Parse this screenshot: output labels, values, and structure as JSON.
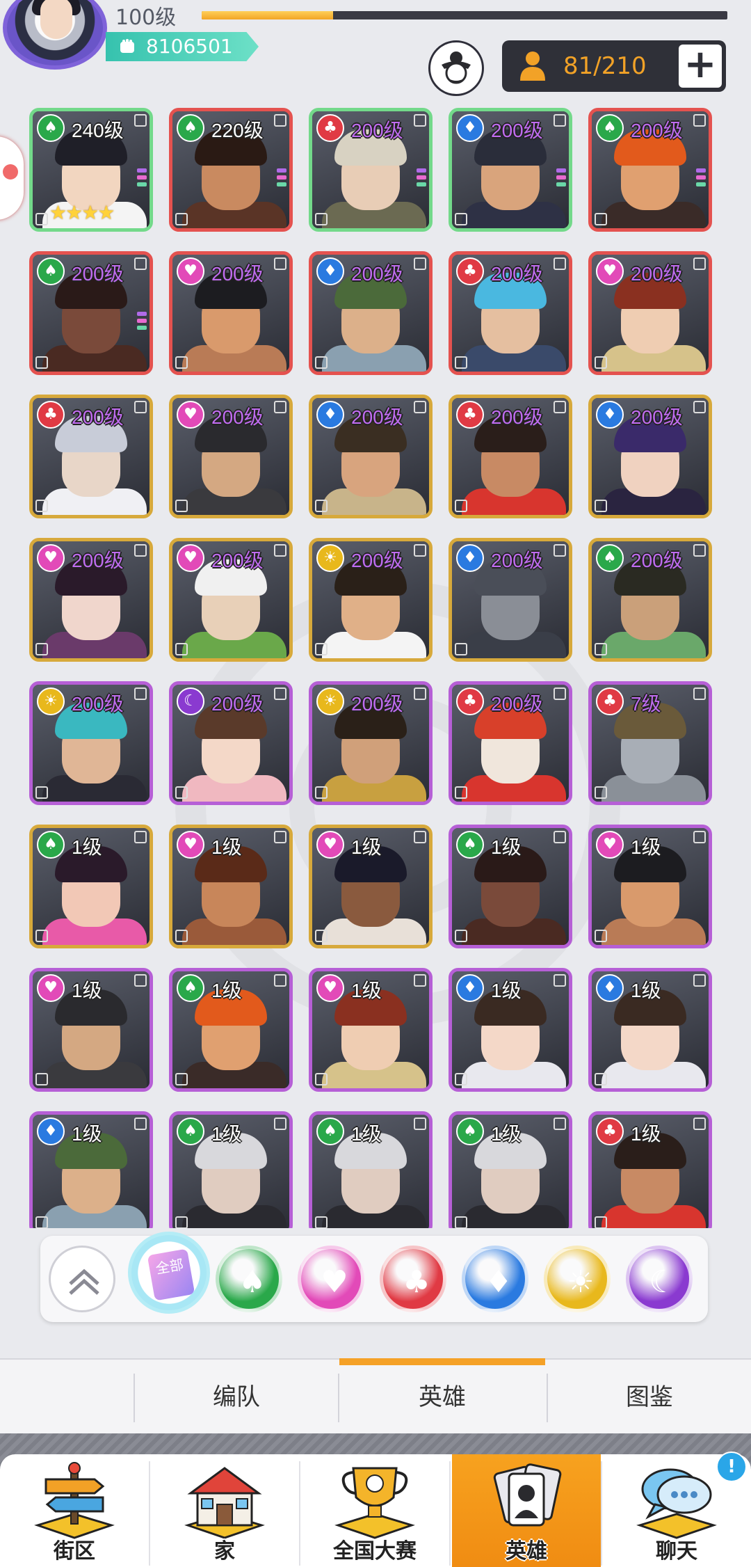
{
  "header": {
    "level": "100级",
    "xp_progress": 0.25,
    "power": "8106501",
    "capacity": "81/210",
    "plus": "+"
  },
  "heroes": [
    {
      "level": "240级",
      "suit": "spade",
      "rarity": "green",
      "stars": 4,
      "skin": "#f2d6c0",
      "hair": "#1f1f28",
      "cloth": "#f4f4f4"
    },
    {
      "level": "220级",
      "suit": "spade",
      "rarity": "red",
      "skin": "#c98a60",
      "hair": "#2a1a14",
      "cloth": "#5a3426"
    },
    {
      "level": "200级",
      "suit": "club",
      "rarity": "green",
      "skin": "#e8cdb6",
      "hair": "#d8d2c2",
      "cloth": "#6b6a52"
    },
    {
      "level": "200级",
      "suit": "diamond",
      "rarity": "green",
      "skin": "#d9a47c",
      "hair": "#2a2d3a",
      "cloth": "#2e3145"
    },
    {
      "level": "200级",
      "suit": "spade",
      "rarity": "red",
      "skin": "#e0a070",
      "hair": "#e25a1c",
      "cloth": "#3a2b28"
    },
    {
      "level": "200级",
      "suit": "spade",
      "rarity": "red",
      "skin": "#7a4a3a",
      "hair": "#2a1a18",
      "cloth": "#4a2a22"
    },
    {
      "level": "200级",
      "suit": "heart",
      "rarity": "red",
      "skin": "#d99a6c",
      "hair": "#1c1c20",
      "cloth": "#b97b56"
    },
    {
      "level": "200级",
      "suit": "diamond",
      "rarity": "red",
      "skin": "#dcb08a",
      "hair": "#4b6a3a",
      "cloth": "#8aa0b0"
    },
    {
      "level": "200级",
      "suit": "club",
      "rarity": "red",
      "skin": "#e5bfa0",
      "hair": "#4ab8e0",
      "cloth": "#3a4a6a"
    },
    {
      "level": "200级",
      "suit": "heart",
      "rarity": "red",
      "skin": "#efcdb2",
      "hair": "#8a3020",
      "cloth": "#d6c28a"
    },
    {
      "level": "200级",
      "suit": "club",
      "rarity": "gold",
      "skin": "#e8d6c8",
      "hair": "#c8ccd8",
      "cloth": "#f0f0f4"
    },
    {
      "level": "200级",
      "suit": "heart",
      "rarity": "gold",
      "skin": "#d4a882",
      "hair": "#2a2a2e",
      "cloth": "#3a3a3e"
    },
    {
      "level": "200级",
      "suit": "diamond",
      "rarity": "gold",
      "skin": "#d8a47e",
      "hair": "#3a2e22",
      "cloth": "#c8b48a"
    },
    {
      "level": "200级",
      "suit": "club",
      "rarity": "gold",
      "skin": "#c88a64",
      "hair": "#2a1e1a",
      "cloth": "#d8352e"
    },
    {
      "level": "200级",
      "suit": "diamond",
      "rarity": "gold",
      "skin": "#f0d2c0",
      "hair": "#3a2a6a",
      "cloth": "#2a2440"
    },
    {
      "level": "200级",
      "suit": "heart",
      "rarity": "gold",
      "skin": "#f0d6cc",
      "hair": "#2a1a2a",
      "cloth": "#6a3a6a"
    },
    {
      "level": "200级",
      "suit": "heart",
      "rarity": "gold",
      "skin": "#e8d0b8",
      "hair": "#f0f0f0",
      "cloth": "#6aa84a"
    },
    {
      "level": "200级",
      "suit": "sun",
      "rarity": "gold",
      "skin": "#e0b088",
      "hair": "#2a2018",
      "cloth": "#f4f4f4"
    },
    {
      "level": "200级",
      "suit": "diamond",
      "rarity": "gold",
      "skin": "#8a8e96",
      "hair": "#4a4e58",
      "cloth": "#3a3e48"
    },
    {
      "level": "200级",
      "suit": "spade",
      "rarity": "gold",
      "skin": "#caa07a",
      "hair": "#2a2a22",
      "cloth": "#6aa86a"
    },
    {
      "level": "200级",
      "suit": "sun",
      "rarity": "purple",
      "skin": "#e0b696",
      "hair": "#3ab8c0",
      "cloth": "#2a2a34"
    },
    {
      "level": "200级",
      "suit": "moon",
      "rarity": "purple",
      "skin": "#f4d8c8",
      "hair": "#5a3a2a",
      "cloth": "#f0b8c0"
    },
    {
      "level": "200级",
      "suit": "sun",
      "rarity": "purple",
      "skin": "#d0a07a",
      "hair": "#2a2018",
      "cloth": "#c8a040"
    },
    {
      "level": "200级",
      "suit": "club",
      "rarity": "purple",
      "skin": "#f0e6dc",
      "hair": "#d8402a",
      "cloth": "#d8352e"
    },
    {
      "level": "7级",
      "suit": "club",
      "rarity": "purple",
      "skin": "#a8aeb6",
      "hair": "#6a5a3a",
      "cloth": "#8a9098"
    },
    {
      "level": "1级",
      "suit": "spade",
      "rarity": "gold",
      "skin": "#f2c8b6",
      "hair": "#2a1a2a",
      "cloth": "#e85aa8"
    },
    {
      "level": "1级",
      "suit": "heart",
      "rarity": "gold",
      "skin": "#c8865a",
      "hair": "#5a2a18",
      "cloth": "#9a5a3a"
    },
    {
      "level": "1级",
      "suit": "heart",
      "rarity": "gold",
      "skin": "#8a5a3e",
      "hair": "#1a1a2a",
      "cloth": "#e8e0d8"
    },
    {
      "level": "1级",
      "suit": "spade",
      "rarity": "purple",
      "skin": "#7a4a3a",
      "hair": "#2a1a18",
      "cloth": "#4a2a22"
    },
    {
      "level": "1级",
      "suit": "heart",
      "rarity": "purple",
      "skin": "#d99a6c",
      "hair": "#1c1c20",
      "cloth": "#b97b56"
    },
    {
      "level": "1级",
      "suit": "heart",
      "rarity": "purple",
      "skin": "#d4a882",
      "hair": "#2a2a2e",
      "cloth": "#3a3a3e"
    },
    {
      "level": "1级",
      "suit": "spade",
      "rarity": "purple",
      "skin": "#e0a070",
      "hair": "#e25a1c",
      "cloth": "#3a2b28"
    },
    {
      "level": "1级",
      "suit": "heart",
      "rarity": "purple",
      "skin": "#efcdb2",
      "hair": "#8a3020",
      "cloth": "#d6c28a"
    },
    {
      "level": "1级",
      "suit": "diamond",
      "rarity": "purple",
      "skin": "#f4d8c8",
      "hair": "#3a2a22",
      "cloth": "#e8e8ee"
    },
    {
      "level": "1级",
      "suit": "diamond",
      "rarity": "purple",
      "skin": "#f4d8c8",
      "hair": "#3a2a22",
      "cloth": "#e8e8ee"
    },
    {
      "level": "1级",
      "suit": "diamond",
      "rarity": "purple",
      "skin": "#dcb08a",
      "hair": "#4b6a3a",
      "cloth": "#8aa0b0"
    },
    {
      "level": "1级",
      "suit": "spade",
      "rarity": "purple",
      "skin": "#e0ccc0",
      "hair": "#d8d8dc",
      "cloth": "#2a2a30"
    },
    {
      "level": "1级",
      "suit": "spade",
      "rarity": "purple",
      "skin": "#e0ccc0",
      "hair": "#d8d8dc",
      "cloth": "#2a2a30"
    },
    {
      "level": "1级",
      "suit": "spade",
      "rarity": "purple",
      "skin": "#e0ccc0",
      "hair": "#d8d8dc",
      "cloth": "#2a2a30"
    },
    {
      "level": "1级",
      "suit": "club",
      "rarity": "purple",
      "skin": "#c88a64",
      "hair": "#2a1e1a",
      "cloth": "#d8352e"
    }
  ],
  "filters": [
    {
      "id": "collapse",
      "icon": "chevron-up-icon"
    },
    {
      "id": "all",
      "icon": "all-cards-icon",
      "label": "全部"
    },
    {
      "id": "spade",
      "icon": "spade-icon",
      "color": "#2aa84a"
    },
    {
      "id": "heart",
      "icon": "heart-icon",
      "color": "#e24ab8"
    },
    {
      "id": "club",
      "icon": "club-icon",
      "color": "#e03a44"
    },
    {
      "id": "diamond",
      "icon": "diamond-icon",
      "color": "#2a7ae0"
    },
    {
      "id": "sun",
      "icon": "sun-icon",
      "color": "#e8b81c"
    },
    {
      "id": "moon",
      "icon": "moon-icon",
      "color": "#8a3ad0"
    }
  ],
  "tabs": [
    {
      "label": "编队"
    },
    {
      "label": "英雄",
      "active": true
    },
    {
      "label": "图鉴"
    }
  ],
  "bottom_nav": [
    {
      "label": "街区",
      "icon": "signpost-icon"
    },
    {
      "label": "家",
      "icon": "house-icon"
    },
    {
      "label": "全国大赛",
      "icon": "trophy-icon"
    },
    {
      "label": "英雄",
      "icon": "hero-cards-icon",
      "active": true
    },
    {
      "label": "聊天",
      "icon": "chat-bubble-icon",
      "badge": "!"
    }
  ],
  "colors": {
    "accent": "#f5a127",
    "rarity_green": "#73d98a",
    "rarity_red": "#e4524f",
    "rarity_gold": "#d7a93b",
    "rarity_purple": "#b65fd6"
  }
}
